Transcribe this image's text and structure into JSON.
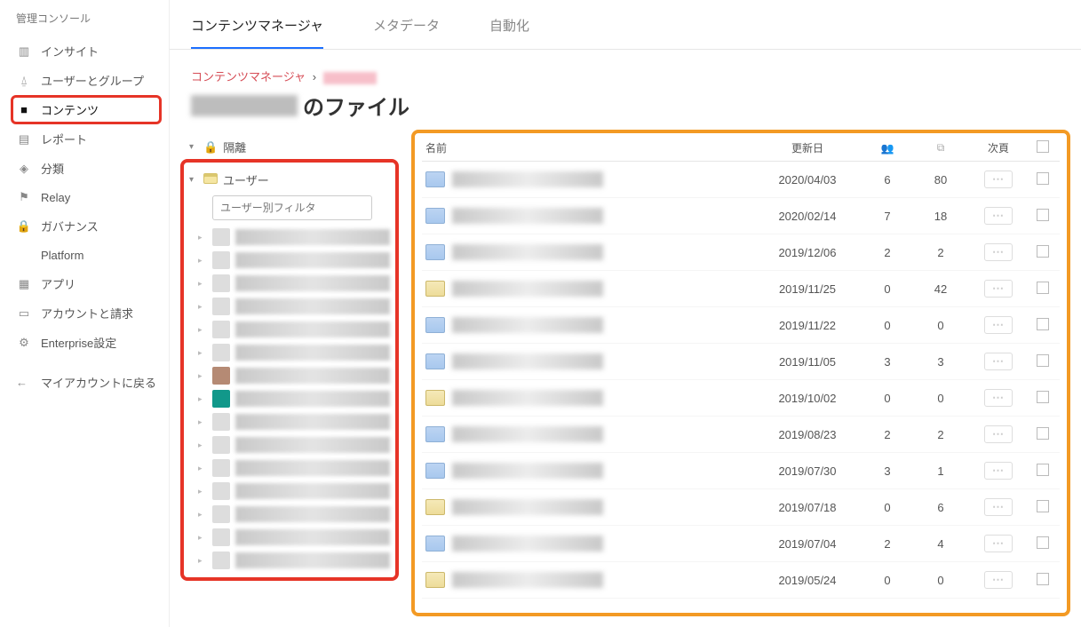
{
  "sidebar": {
    "title": "管理コンソール",
    "items": [
      {
        "label": "インサイト",
        "icon": "bars-icon"
      },
      {
        "label": "ユーザーとグループ",
        "icon": "users-icon"
      },
      {
        "label": "コンテンツ",
        "icon": "folder-icon",
        "active": true
      },
      {
        "label": "レポート",
        "icon": "document-icon"
      },
      {
        "label": "分類",
        "icon": "tag-icon"
      },
      {
        "label": "Relay",
        "icon": "flag-icon"
      },
      {
        "label": "ガバナンス",
        "icon": "lock-icon"
      },
      {
        "label": "Platform",
        "icon": "code-icon"
      },
      {
        "label": "アプリ",
        "icon": "grid-icon"
      },
      {
        "label": "アカウントと請求",
        "icon": "card-icon"
      },
      {
        "label": "Enterprise設定",
        "icon": "gear-icon"
      }
    ],
    "back_label": "マイアカウントに戻る"
  },
  "tabs": [
    {
      "label": "コンテンツマネージャ",
      "active": true
    },
    {
      "label": "メタデータ"
    },
    {
      "label": "自動化"
    }
  ],
  "breadcrumb": {
    "root": "コンテンツマネージャ"
  },
  "page_title_suffix": "のファイル",
  "tree": {
    "quarantine": "隔離",
    "users_label": "ユーザー",
    "filter_placeholder": "ユーザー別フィルタ",
    "user_count": 15
  },
  "table": {
    "headers": {
      "name": "名前",
      "date": "更新日",
      "next": "次頁"
    },
    "rows": [
      {
        "icon": "shared",
        "date": "2020/04/03",
        "collab": "6",
        "files": "80"
      },
      {
        "icon": "shared",
        "date": "2020/02/14",
        "collab": "7",
        "files": "18"
      },
      {
        "icon": "shared",
        "date": "2019/12/06",
        "collab": "2",
        "files": "2"
      },
      {
        "icon": "plain",
        "date": "2019/11/25",
        "collab": "0",
        "files": "42"
      },
      {
        "icon": "shared",
        "date": "2019/11/22",
        "collab": "0",
        "files": "0"
      },
      {
        "icon": "shared",
        "date": "2019/11/05",
        "collab": "3",
        "files": "3"
      },
      {
        "icon": "plain",
        "date": "2019/10/02",
        "collab": "0",
        "files": "0"
      },
      {
        "icon": "shared",
        "date": "2019/08/23",
        "collab": "2",
        "files": "2"
      },
      {
        "icon": "shared",
        "date": "2019/07/30",
        "collab": "3",
        "files": "1"
      },
      {
        "icon": "plain",
        "date": "2019/07/18",
        "collab": "0",
        "files": "6"
      },
      {
        "icon": "shared",
        "date": "2019/07/04",
        "collab": "2",
        "files": "4"
      },
      {
        "icon": "plain",
        "date": "2019/05/24",
        "collab": "0",
        "files": "0"
      }
    ],
    "more_glyph": "⋯"
  },
  "icons": {
    "bars": "▥",
    "users": "⍙",
    "folder": "▅",
    "document": "▤",
    "tag": "◈",
    "flag": "⚑",
    "lock": "🔒",
    "code": "</>",
    "grid": "▦",
    "card": "▭",
    "gear": "⚙",
    "back": "←",
    "chev_right": "▸",
    "chev_down": "▾",
    "collab": "👥",
    "files": "⧉"
  }
}
